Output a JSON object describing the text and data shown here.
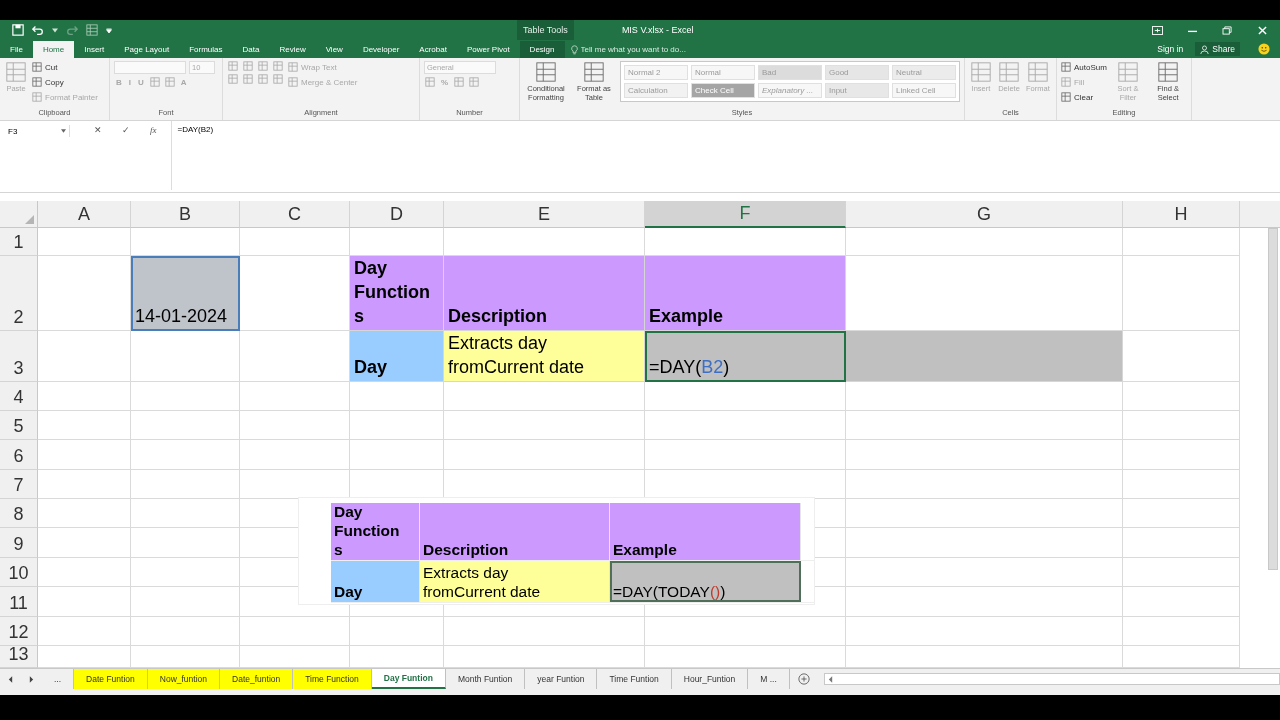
{
  "window": {
    "title": "MIS V.xlsx - Excel",
    "context_group": "Table Tools",
    "sign_in": "Sign in",
    "share": "Share"
  },
  "ribbon_tabs": [
    {
      "label": "File",
      "selected": false
    },
    {
      "label": "Home",
      "selected": true
    },
    {
      "label": "Insert",
      "selected": false
    },
    {
      "label": "Page Layout",
      "selected": false
    },
    {
      "label": "Formulas",
      "selected": false
    },
    {
      "label": "Data",
      "selected": false
    },
    {
      "label": "Review",
      "selected": false
    },
    {
      "label": "View",
      "selected": false
    },
    {
      "label": "Developer",
      "selected": false
    },
    {
      "label": "Acrobat",
      "selected": false
    },
    {
      "label": "Power Pivot",
      "selected": false
    },
    {
      "label": "Design",
      "selected": false
    }
  ],
  "tell_me": {
    "placeholder": "Tell me what you want to do..."
  },
  "ribbon_groups": [
    {
      "label": "Clipboard",
      "columns": [
        [
          {
            "kind": "large",
            "label": "Paste",
            "disabled": true
          }
        ],
        [
          {
            "kind": "small",
            "label": "Cut",
            "disabled": false
          },
          {
            "kind": "small",
            "label": "Copy",
            "disabled": false
          },
          {
            "kind": "small",
            "label": "Format Painter",
            "disabled": true
          }
        ]
      ]
    },
    {
      "label": "Font",
      "columns": [
        [
          {
            "kind": "row",
            "items": [
              {
                "kind": "field",
                "disabled": true
              },
              {
                "kind": "small_field",
                "value": "10",
                "disabled": true
              }
            ]
          },
          {
            "kind": "row",
            "items": [
              {
                "kind": "glyph",
                "label": "B",
                "disabled": true
              },
              {
                "kind": "glyph",
                "label": "I",
                "disabled": true
              },
              {
                "kind": "glyph",
                "label": "U",
                "disabled": true
              },
              {
                "kind": "icon",
                "disabled": true
              },
              {
                "kind": "icon",
                "disabled": true
              },
              {
                "kind": "glyph",
                "label": "A",
                "disabled": true
              }
            ]
          }
        ]
      ]
    },
    {
      "label": "Alignment",
      "columns": [
        [
          {
            "kind": "row",
            "items": [
              {
                "kind": "icon",
                "disabled": true
              },
              {
                "kind": "icon",
                "disabled": true
              },
              {
                "kind": "icon",
                "disabled": true
              },
              {
                "kind": "icon",
                "disabled": true
              }
            ]
          },
          {
            "kind": "row",
            "items": [
              {
                "kind": "icon",
                "disabled": true
              },
              {
                "kind": "icon",
                "disabled": true
              },
              {
                "kind": "icon",
                "disabled": true
              },
              {
                "kind": "icon",
                "disabled": true
              }
            ]
          }
        ],
        [
          {
            "kind": "small",
            "label": "Wrap Text",
            "disabled": true
          },
          {
            "kind": "small",
            "label": "Merge & Center",
            "disabled": true
          }
        ]
      ]
    },
    {
      "label": "Number",
      "columns": [
        [
          {
            "kind": "field",
            "value": "General",
            "disabled": true
          },
          {
            "kind": "row",
            "items": [
              {
                "kind": "icon",
                "disabled": true
              },
              {
                "kind": "glyph",
                "label": "%",
                "disabled": true
              },
              {
                "kind": "icon",
                "disabled": true
              },
              {
                "kind": "icon",
                "disabled": true
              }
            ]
          }
        ]
      ]
    },
    {
      "label": "Styles",
      "columns": [
        [
          {
            "kind": "large",
            "label": "Conditional Formatting",
            "disabled": false
          }
        ],
        [
          {
            "kind": "large",
            "label": "Format as Table",
            "disabled": false
          }
        ],
        [
          {
            "kind": "gallery",
            "cells": [
              {
                "label": "Normal 2",
                "color": "#f7f7f7",
                "italic": false
              },
              {
                "label": "Normal",
                "color": "#f7f7f7",
                "italic": false
              },
              {
                "label": "Bad",
                "color": "#dcdcdc",
                "italic": false
              },
              {
                "label": "Good",
                "color": "#e6e6e6",
                "italic": false
              },
              {
                "label": "Neutral",
                "color": "#ececec",
                "italic": false
              },
              {
                "label": "Calculation",
                "color": "#f2f2f2",
                "italic": false
              },
              {
                "label": "Check Cell",
                "color": "#a5a5a5",
                "italic": false
              },
              {
                "label": "Explanatory ...",
                "color": "#f7f7f7",
                "italic": true
              },
              {
                "label": "Input",
                "color": "#e8e8e8",
                "italic": false
              },
              {
                "label": "Linked Cell",
                "color": "#f7f7f7",
                "italic": false
              }
            ]
          }
        ]
      ]
    },
    {
      "label": "Cells",
      "columns": [
        [
          {
            "kind": "large",
            "label": "Insert",
            "disabled": true
          }
        ],
        [
          {
            "kind": "large",
            "label": "Delete",
            "disabled": true
          }
        ],
        [
          {
            "kind": "large",
            "label": "Format",
            "disabled": true
          }
        ]
      ]
    },
    {
      "label": "Editing",
      "columns": [
        [
          {
            "kind": "small",
            "label": "AutoSum",
            "disabled": false
          },
          {
            "kind": "small",
            "label": "Fill",
            "disabled": true
          },
          {
            "kind": "small",
            "label": "Clear",
            "disabled": false
          }
        ],
        [
          {
            "kind": "large",
            "label": "Sort & Filter",
            "disabled": true
          }
        ],
        [
          {
            "kind": "large",
            "label": "Find & Select",
            "disabled": false
          }
        ]
      ]
    }
  ],
  "formula_bar": {
    "name_box": "F3",
    "cancel": "✕",
    "enter": "✓",
    "function_button": "fx",
    "formula": "=DAY(B2)"
  },
  "sheet": {
    "columns": [
      {
        "label": "A",
        "selected": false
      },
      {
        "label": "B",
        "selected": false
      },
      {
        "label": "C",
        "selected": false
      },
      {
        "label": "D",
        "selected": false
      },
      {
        "label": "E",
        "selected": false
      },
      {
        "label": "F",
        "selected": true
      },
      {
        "label": "G",
        "selected": false
      },
      {
        "label": "H",
        "selected": false
      }
    ],
    "rows": [
      {
        "label": "1",
        "selected": false
      },
      {
        "label": "2",
        "selected": false
      },
      {
        "label": "3",
        "selected": false
      },
      {
        "label": "4",
        "selected": false
      },
      {
        "label": "5",
        "selected": false
      },
      {
        "label": "6",
        "selected": false
      },
      {
        "label": "7",
        "selected": false
      },
      {
        "label": "8",
        "selected": false
      },
      {
        "label": "9",
        "selected": false
      },
      {
        "label": "10",
        "selected": false
      },
      {
        "label": "11",
        "selected": false
      },
      {
        "label": "12",
        "selected": false
      },
      {
        "label": "13",
        "selected": false
      }
    ],
    "date_cell": {
      "parts": [
        {
          "text": "14-01-2024",
          "color": "#000000"
        }
      ],
      "color": "#bfc3ca",
      "bold": false,
      "selected": true
    },
    "table": {
      "rows": [
        {
          "cells": [
            {
              "parts": [
                {
                  "text": "Day Functions",
                  "color": "#000000"
                }
              ],
              "color": "#cc99ff",
              "bold": true,
              "selected": false
            },
            {
              "parts": [
                {
                  "text": "Description",
                  "color": "#000000"
                }
              ],
              "color": "#cc99ff",
              "bold": true,
              "selected": false
            },
            {
              "parts": [
                {
                  "text": "Example",
                  "color": "#000000"
                }
              ],
              "color": "#cc99ff",
              "bold": true,
              "selected": false
            }
          ]
        },
        {
          "cells": [
            {
              "parts": [
                {
                  "text": "Day",
                  "color": "#000000"
                }
              ],
              "color": "#99ccff",
              "bold": true,
              "selected": false
            },
            {
              "parts": [
                {
                  "text": "Extracts day fromCurrent date",
                  "color": "#000000"
                }
              ],
              "color": "#ffff99",
              "bold": false,
              "selected": false
            },
            {
              "parts": [
                {
                  "text": "=DAY(",
                  "color": "#000000"
                },
                {
                  "text": "B2",
                  "color": "#3d6fc4"
                },
                {
                  "text": ")",
                  "color": "#000000"
                }
              ],
              "color": "#c0c0c0",
              "bold": false,
              "selected": true
            }
          ]
        }
      ]
    }
  },
  "pasted_table": {
    "rows": [
      {
        "cells": [
          {
            "parts": [
              {
                "text": "Day Functions",
                "color": "#000000"
              }
            ],
            "color": "#cc99ff",
            "bold": true,
            "selected": false
          },
          {
            "parts": [
              {
                "text": "Description",
                "color": "#000000"
              }
            ],
            "color": "#cc99ff",
            "bold": true,
            "selected": false
          },
          {
            "parts": [
              {
                "text": "Example",
                "color": "#000000"
              }
            ],
            "color": "#cc99ff",
            "bold": true,
            "selected": false
          }
        ]
      },
      {
        "cells": [
          {
            "parts": [
              {
                "text": "Day",
                "color": "#000000"
              }
            ],
            "color": "#99ccff",
            "bold": true,
            "selected": false
          },
          {
            "parts": [
              {
                "text": "Extracts day fromCurrent date",
                "color": "#000000"
              }
            ],
            "color": "#ffff99",
            "bold": false,
            "selected": false
          },
          {
            "parts": [
              {
                "text": "=DAY(TODAY",
                "color": "#000000"
              },
              {
                "text": "()",
                "color": "#c0392b"
              },
              {
                "text": ")",
                "color": "#000000"
              }
            ],
            "color": "#c0c0c0",
            "bold": false,
            "selected": true
          }
        ]
      }
    ]
  },
  "sheet_tabs": [
    {
      "label": "...",
      "color": "#f0f0f0",
      "selected": false
    },
    {
      "label": "Date Funtion",
      "color": "#ffff00",
      "selected": false
    },
    {
      "label": "Now_funtion",
      "color": "#ffff00",
      "selected": false
    },
    {
      "label": "Date_funtion",
      "color": "#ffff00",
      "selected": false
    },
    {
      "label": "Time Function",
      "color": "#ffff00",
      "selected": false
    },
    {
      "label": "Day Funtion",
      "color": "#ffffff",
      "selected": true
    },
    {
      "label": "Month Funtion",
      "color": "#f0f0f0",
      "selected": false
    },
    {
      "label": "year Funtion",
      "color": "#f0f0f0",
      "selected": false
    },
    {
      "label": "Time Funtion",
      "color": "#f0f0f0",
      "selected": false
    },
    {
      "label": "Hour_Funtion",
      "color": "#f0f0f0",
      "selected": false
    },
    {
      "label": "M ...",
      "color": "#f0f0f0",
      "selected": false
    }
  ]
}
